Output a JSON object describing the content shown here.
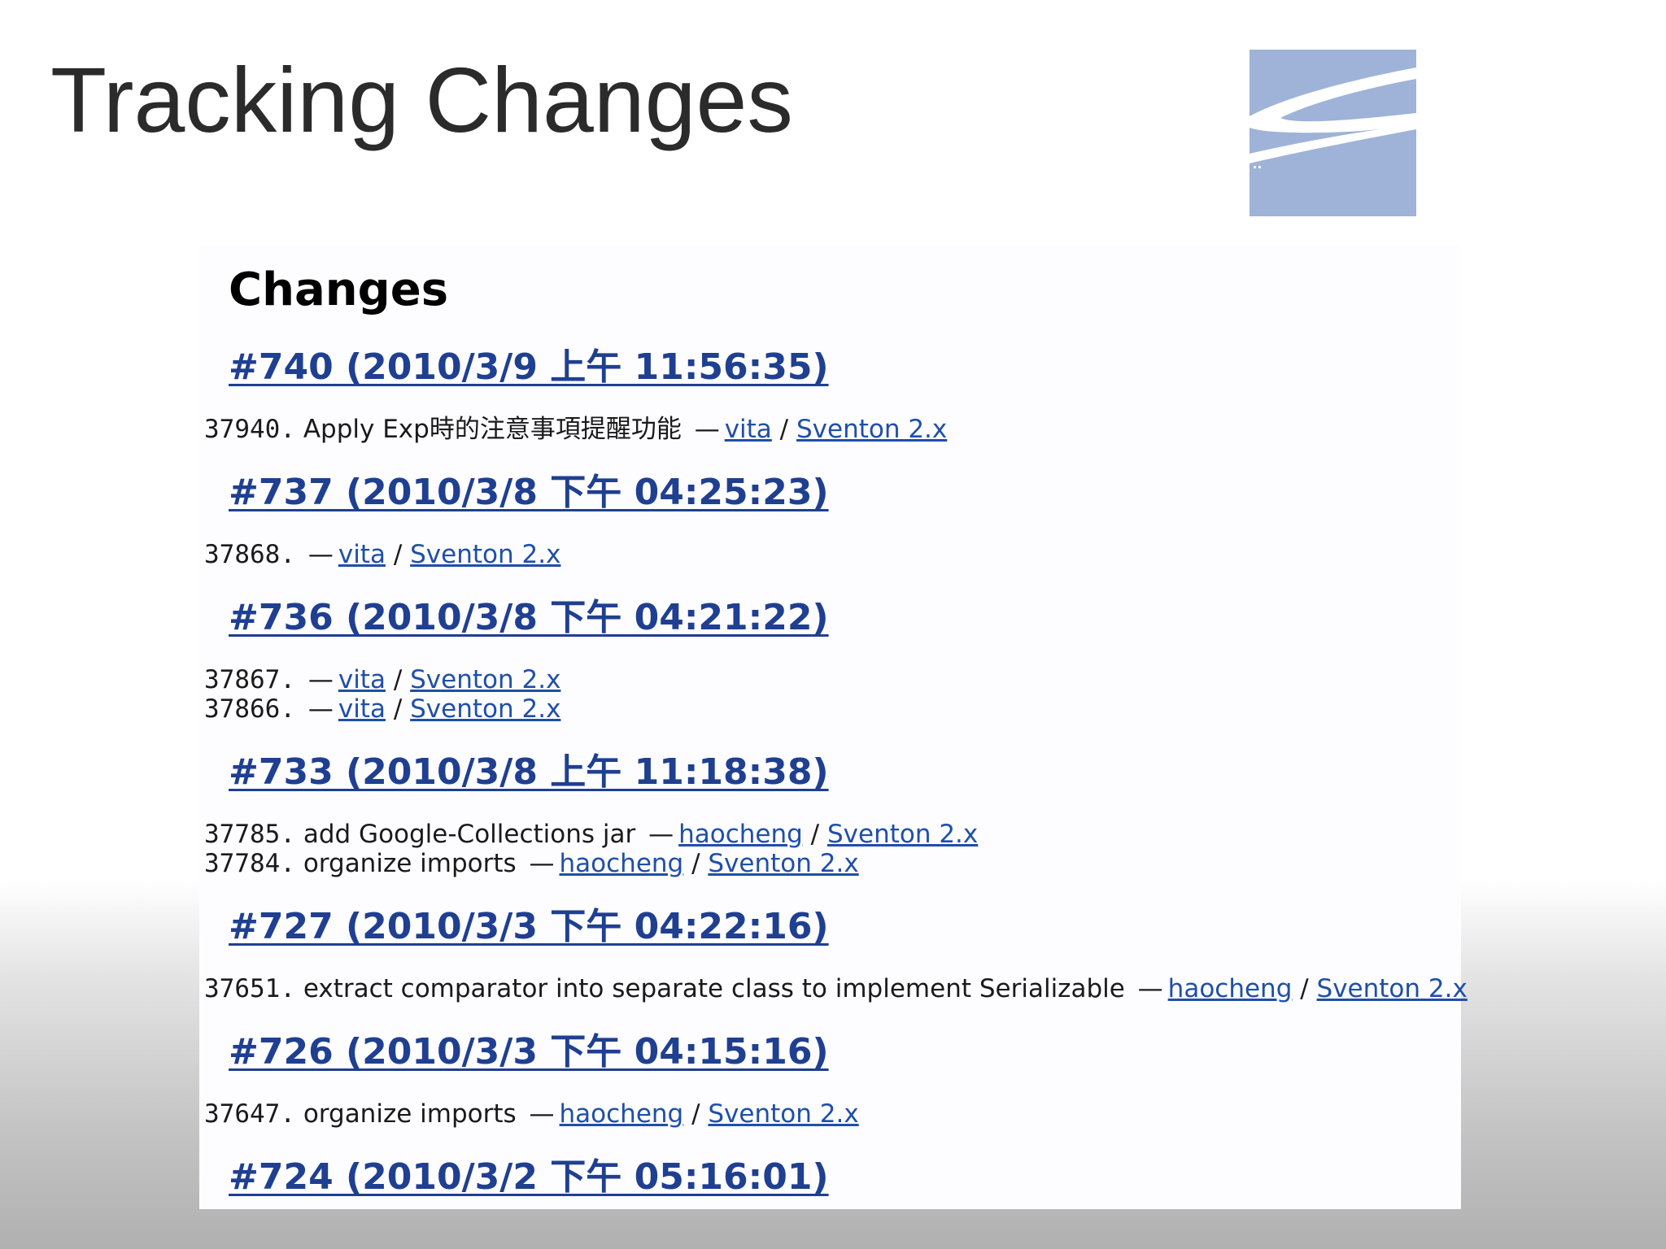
{
  "slide": {
    "title": "Tracking Changes"
  },
  "logo": {
    "icon": "sventon-logo-icon",
    "color": "#9fb3d8"
  },
  "panel": {
    "heading": "Changes",
    "builds": [
      {
        "label": "#740 (2010/3/9 上午 11:56:35)",
        "entries": [
          {
            "rev": "37940.",
            "message": "Apply Exp時的注意事項提醒功能",
            "user": "vita",
            "project": "Sventon 2.x"
          }
        ]
      },
      {
        "label": "#737 (2010/3/8 下午 04:25:23)",
        "entries": [
          {
            "rev": "37868.",
            "message": "",
            "user": "vita",
            "project": "Sventon 2.x"
          }
        ]
      },
      {
        "label": "#736 (2010/3/8 下午 04:21:22)",
        "entries": [
          {
            "rev": "37867.",
            "message": "",
            "user": "vita",
            "project": "Sventon 2.x"
          },
          {
            "rev": "37866.",
            "message": "",
            "user": "vita",
            "project": "Sventon 2.x"
          }
        ]
      },
      {
        "label": "#733 (2010/3/8 上午 11:18:38)",
        "entries": [
          {
            "rev": "37785.",
            "message": "add Google-Collections jar",
            "user": "haocheng",
            "project": "Sventon 2.x"
          },
          {
            "rev": "37784.",
            "message": "organize imports",
            "user": "haocheng",
            "project": "Sventon 2.x"
          }
        ]
      },
      {
        "label": "#727 (2010/3/3 下午 04:22:16)",
        "entries": [
          {
            "rev": "37651.",
            "message": "extract comparator into separate class to implement Serializable",
            "user": "haocheng",
            "project": "Sventon 2.x"
          }
        ]
      },
      {
        "label": "#726 (2010/3/3 下午 04:15:16)",
        "entries": [
          {
            "rev": "37647.",
            "message": "organize imports",
            "user": "haocheng",
            "project": "Sventon 2.x"
          }
        ]
      },
      {
        "label": "#724 (2010/3/2 下午 05:16:01)",
        "entries": []
      }
    ]
  }
}
